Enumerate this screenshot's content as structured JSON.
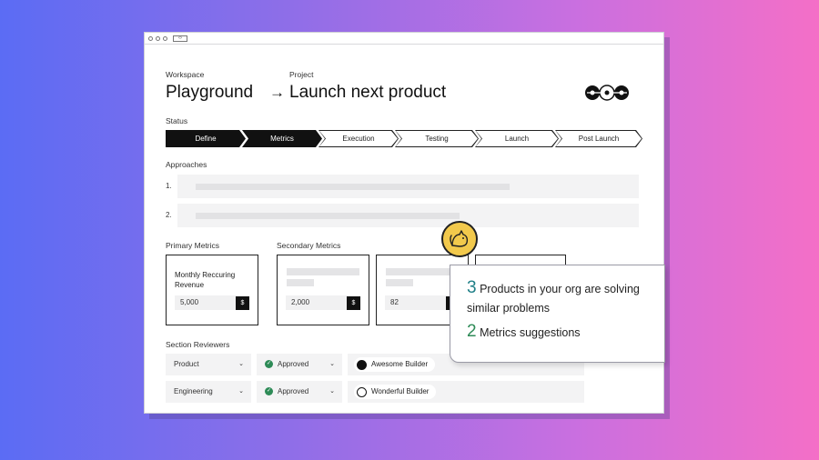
{
  "breadcrumb": {
    "workspace_label": "Workspace",
    "workspace_name": "Playground",
    "arrow": "→",
    "project_label": "Project",
    "project_name": "Launch next product"
  },
  "status": {
    "label": "Status",
    "steps": [
      "Define",
      "Metrics",
      "Execution",
      "Testing",
      "Launch",
      "Post Launch"
    ],
    "completed_steps": 2
  },
  "approaches": {
    "label": "Approaches",
    "items": [
      "1.",
      "2."
    ]
  },
  "primary_metrics": {
    "label": "Primary Metrics",
    "title": "Monthly Reccuring Revenue",
    "value": "5,000",
    "unit": "$"
  },
  "secondary_metrics": {
    "label": "Secondary Metrics",
    "cards": [
      {
        "value": "2,000",
        "unit": "$"
      },
      {
        "value": "82",
        "unit": "$"
      }
    ]
  },
  "reviewers": {
    "label": "Section Reviewers",
    "rows": [
      {
        "section": "Product",
        "status": "Approved",
        "reviewer": "Awesome Builder"
      },
      {
        "section": "Engineering",
        "status": "Approved",
        "reviewer": "Wonderful Builder"
      }
    ]
  },
  "popup": {
    "count1": "3",
    "text1": "Products in your org are solving",
    "text1b": "similar problems",
    "count2": "2",
    "text2": "Metrics suggestions"
  },
  "colors": {
    "accent_teal": "#1f7f87",
    "accent_green": "#2e8b57",
    "badge_yellow": "#f2c94c"
  },
  "icons": {
    "logo": "connected-circles-logo",
    "badge": "cat-mascot-icon",
    "approved": "check-circle-icon",
    "dropdown": "chevron-down-icon"
  }
}
